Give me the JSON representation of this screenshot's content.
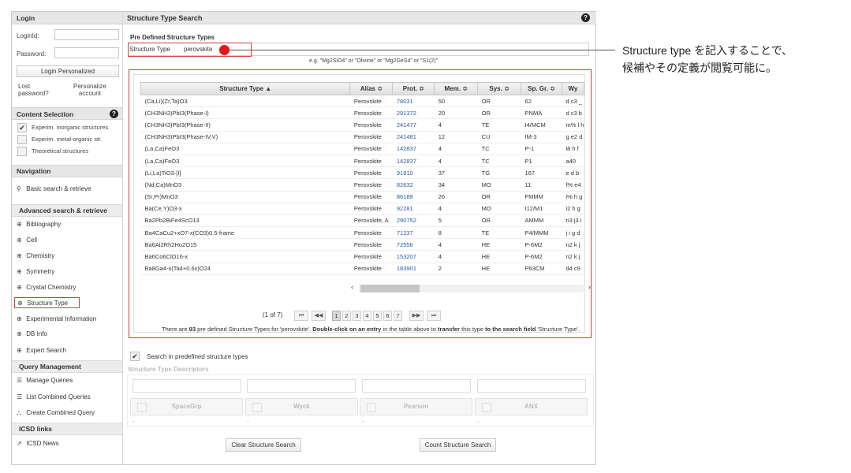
{
  "sidebar": {
    "login": {
      "header": "Login",
      "loginid_label": "LoginId:",
      "password_label": "Password:",
      "button": "Login Personalized",
      "lost_password": "Lost\npassword?",
      "personalize_account": "Personalize\naccount"
    },
    "content_selection": {
      "header": "Content Selection",
      "items": [
        {
          "label": "Experim. inorganic structures",
          "checked": true
        },
        {
          "label": "Experim. metal-organic str.",
          "checked": false
        },
        {
          "label": "Theoretical structures",
          "checked": false
        }
      ]
    },
    "navigation": {
      "header": "Navigation",
      "basic": "Basic search & retrieve",
      "advanced_header": "Advanced search & retrieve",
      "items": [
        "Bibliography",
        "Cell",
        "Chemistry",
        "Symmetry",
        "Crystal Chemistry",
        "Structure Type",
        "Experimental Information",
        "DB Info",
        "Expert Search"
      ],
      "selected": "Structure Type"
    },
    "query_management": {
      "header": "Query Management",
      "items": [
        "Manage Queries",
        "List Combined Queries",
        "Create Combined Query"
      ]
    },
    "icsd_links": {
      "header": "ICSD links",
      "items": [
        "ICSD News"
      ]
    }
  },
  "main": {
    "title": "Structure Type Search",
    "predefined_title": "Pre Defined Structure Types",
    "structure_type_label": "Structure Type",
    "structure_type_value": "perovskite",
    "example_text": "e.g. \"Mg2SiO4\" or \"Olivine\" or \"Mg2GeS4\" or \"S1(2)\"",
    "table": {
      "columns": [
        "Structure Type ▲",
        "Alias ≎",
        "Prot. ≎",
        "Mem. ≎",
        "Sys. ≎",
        "Sp. Gr. ≎",
        "Wy"
      ],
      "rows": [
        [
          "(Ca,Li)(Zr,Ta)O3",
          "Perovskite",
          "78031",
          "50",
          "OR",
          "62",
          "d c3 _"
        ],
        [
          "(CH3NH3)PbI3(Phase-I)",
          "Perovskite",
          "291372",
          "20",
          "OR",
          "PNMA",
          "d c3 b"
        ],
        [
          "(CH3NH3)PbI3(Phase-II)",
          "Perovskite",
          "241477",
          "4",
          "TE",
          "I4/MCM",
          "m% l h"
        ],
        [
          "(CH3NH3)PbI3(Phase-IV,V)",
          "Perovskite",
          "241481",
          "12",
          "CU",
          "IM-3",
          "g e2 d"
        ],
        [
          "(La,Ca)FeO3",
          "Perovskite",
          "142837",
          "4",
          "TC",
          "P-1",
          "i8 h f"
        ],
        [
          "(La,Ca)FeO3",
          "Perovskite",
          "142837",
          "4",
          "TC",
          "P1",
          "a40"
        ],
        [
          "(Li,La)TiO3-[I]",
          "Perovskite",
          "91810",
          "37",
          "TG",
          "167",
          "e d b"
        ],
        [
          "(Nd,Ca)MnO3",
          "Perovskite",
          "82632",
          "34",
          "MO",
          "11",
          "f% e4"
        ],
        [
          "(Sr,Pr)MnO3",
          "Perovskite",
          "86188",
          "26",
          "OR",
          "FMMM",
          "i% h g"
        ],
        [
          "Ba(Ce,Y)O3-x",
          "Perovskite",
          "92281",
          "4",
          "MO",
          "I12/M1",
          "i2 h g"
        ],
        [
          "Ba2Pb2BiFe4ScO13",
          "Perovskite, A",
          "290752",
          "5",
          "OR",
          "AMMM",
          "n3 j3 i"
        ],
        [
          "Ba4CaCu2+xO7-x(CO3)0.5-frame",
          "Perovskite",
          "71237",
          "8",
          "TE",
          "P4/MMM",
          "j i g d"
        ],
        [
          "Ba6Al2Rh2Ho2O15",
          "Perovskite",
          "72556",
          "4",
          "HE",
          "P-6M2",
          "n2 k j"
        ],
        [
          "Ba6Co6ClO16-x",
          "Perovskite",
          "153207",
          "4",
          "HE",
          "P-6M2",
          "n2 k j"
        ],
        [
          "Ba8Ga4-x(Ta4+0.6x)O24",
          "Perovskite",
          "183901",
          "2",
          "HE",
          "P63CM",
          "d4 c9"
        ]
      ]
    },
    "pager": {
      "status": "(1 of 7)",
      "first": "⏮",
      "prev": "◀◀",
      "pages": [
        "1",
        "2",
        "3",
        "4",
        "5",
        "6",
        "7"
      ],
      "current": "1",
      "next": "▶▶",
      "last": "⏭"
    },
    "note": {
      "p1": "There are ",
      "count": "93",
      "p2": " pre defined Structure Types for 'perovskite'. ",
      "b1": "Double-click on an entry",
      "p3": " in the table above to ",
      "b2": "transfer",
      "p4": " this type ",
      "b3": "to the search field",
      "p5": " 'Structure Type'."
    },
    "search_predefined_label": "Search in predefined structure types",
    "descriptors_title": "Structure Type Descriptors",
    "descriptor_columns": [
      "SpaceGrp",
      "Wyck",
      "Pearson",
      "ANX"
    ],
    "clear_button": "Clear Structure Search",
    "count_button": "Count Structure Search"
  },
  "annotation": {
    "line1": "Structure type を記入することで、",
    "line2": "候補やその定義が閲覧可能に。"
  },
  "colors": {
    "highlight": "#d93b3b",
    "red_dot": "#e4161c",
    "link_blue": "#2a5aa8"
  }
}
